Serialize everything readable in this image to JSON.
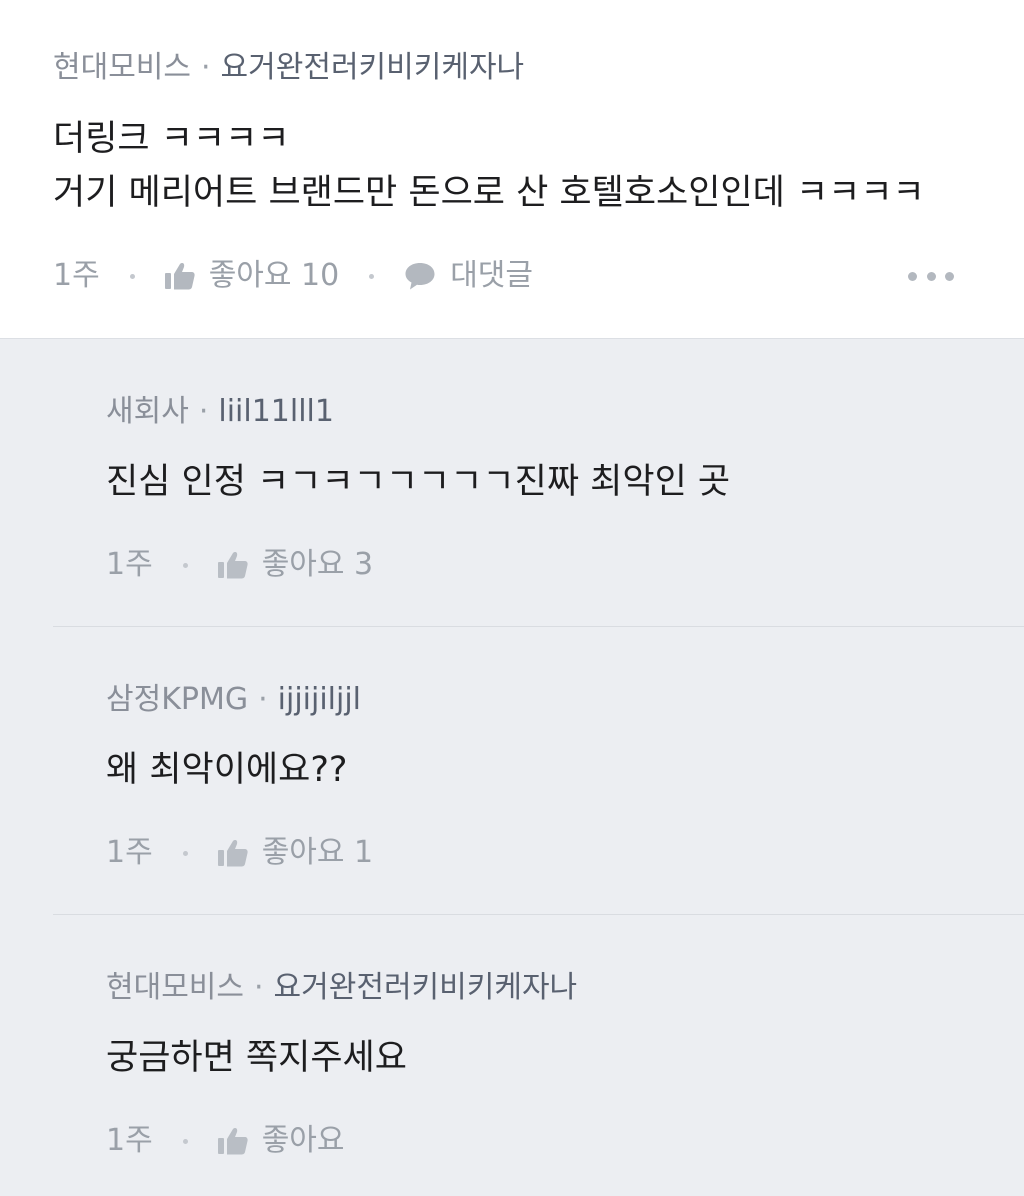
{
  "main_comment": {
    "company": "현대모비스",
    "separator": "·",
    "nickname": "요거완전러키비키케자나",
    "lines": [
      "더링크 ㅋㅋㅋㅋ",
      "거기 메리어트 브랜드만 돈으로 산 호텔호소인인데 ㅋㅋㅋㅋ"
    ],
    "time": "1주",
    "like_label": "좋아요 10",
    "reply_label": "대댓글",
    "icons": [
      "thumbs-up-icon",
      "speech-bubble-icon",
      "more-dots-icon"
    ]
  },
  "replies": [
    {
      "company": "새회사",
      "separator": "·",
      "nickname": "liil11lll1",
      "text": "진심 인정 ㅋㄱㅋㄱㄱㄱㄱㄱ진짜 최악인 곳",
      "time": "1주",
      "like_label": "좋아요 3"
    },
    {
      "company": "삼정KPMG",
      "separator": "·",
      "nickname": "ijjijiljjl",
      "text": "왜 최악이에요??",
      "time": "1주",
      "like_label": "좋아요 1"
    },
    {
      "company": "현대모비스",
      "separator": "·",
      "nickname": "요거완전러키비키케자나",
      "text": "궁금하면 쪽지주세요",
      "time": "1주",
      "like_label": "좋아요"
    }
  ],
  "colors": {
    "page_background": "#eceef2",
    "main_background": "#ffffff",
    "meta_text": "#9aa0a8",
    "body_text": "#1d1d1f"
  }
}
